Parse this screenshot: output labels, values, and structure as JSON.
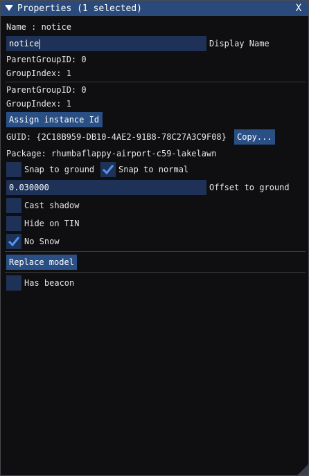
{
  "window": {
    "title": "Properties (1 selected)",
    "close_glyph": "X",
    "collapse_icon": "triangle-down-icon"
  },
  "name_line": "Name : notice",
  "display_name": {
    "value": "notice",
    "label": "Display Name"
  },
  "group1": {
    "parent": "ParentGroupID: 0",
    "index": "GroupIndex: 1"
  },
  "group2": {
    "parent": "ParentGroupID: 0",
    "index": "GroupIndex: 1"
  },
  "assign_button": "Assign instance Id",
  "guid": {
    "text": "GUID: {2C18B959-DB10-4AE2-91B8-78C27A3C9F08}",
    "copy_button": "Copy..."
  },
  "package": "Package: rhumbaflappy-airport-c59-lakelawn",
  "snap_ground": {
    "label": "Snap to ground",
    "checked": false
  },
  "snap_normal": {
    "label": "Snap to normal",
    "checked": true
  },
  "offset": {
    "value": "0.030000",
    "label": "Offset to ground"
  },
  "cast_shadow": {
    "label": "Cast shadow",
    "checked": false
  },
  "hide_tin": {
    "label": "Hide on TIN",
    "checked": false
  },
  "no_snow": {
    "label": "No Snow",
    "checked": true
  },
  "replace_button": "Replace model",
  "has_beacon": {
    "label": "Has beacon",
    "checked": false
  },
  "colors": {
    "accent": "#2a4f84",
    "field_bg": "#1d3256",
    "check": "#4d94ff"
  }
}
